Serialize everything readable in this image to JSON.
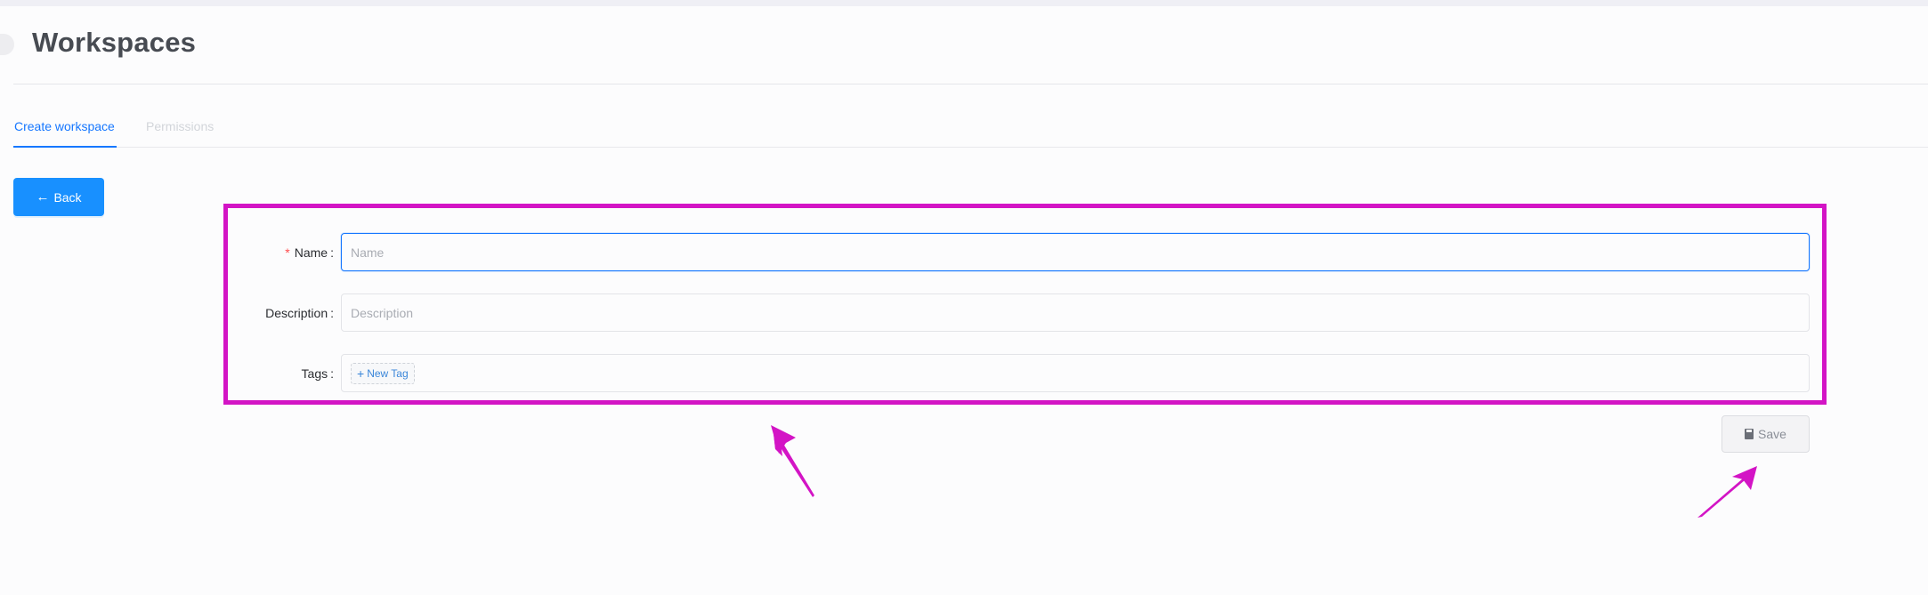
{
  "header": {
    "title": "Workspaces"
  },
  "tabs": [
    {
      "label": "Create workspace",
      "state": "active"
    },
    {
      "label": "Permissions",
      "state": "disabled"
    }
  ],
  "back_button": {
    "label": "Back",
    "icon": "arrow-left-icon"
  },
  "form": {
    "name": {
      "label": "Name",
      "required": true,
      "placeholder": "Name",
      "value": ""
    },
    "description": {
      "label": "Description",
      "placeholder": "Description",
      "value": ""
    },
    "tags": {
      "label": "Tags",
      "new_tag_label": "New Tag",
      "items": []
    },
    "colon": ":",
    "required_mark": "*"
  },
  "save_button": {
    "label": "Save",
    "icon": "save-icon"
  },
  "colors": {
    "primary": "#1890ff",
    "accent_active_tab": "#1677ff",
    "annotation": "#d314c5",
    "required": "#ff4d4f"
  }
}
